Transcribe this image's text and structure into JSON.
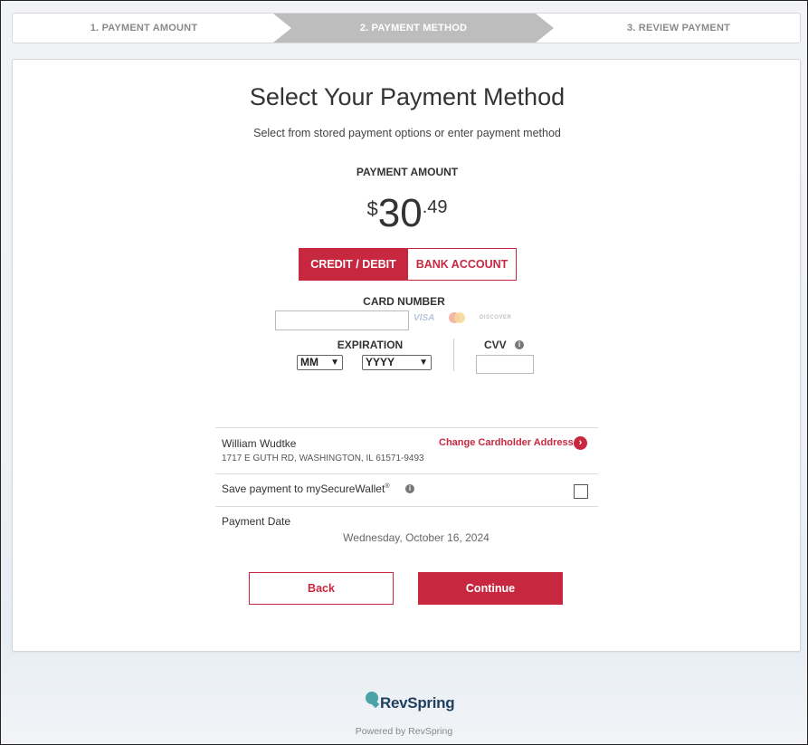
{
  "stepper": {
    "step1": "1. PAYMENT AMOUNT",
    "step2": "2. PAYMENT METHOD",
    "step3": "3. REVIEW PAYMENT"
  },
  "main": {
    "title": "Select Your Payment Method",
    "subtitle": "Select from stored payment options or enter payment method",
    "amount_label": "PAYMENT AMOUNT",
    "amount": {
      "currency": "$",
      "whole": "30",
      "cents": ".49"
    },
    "tabs": [
      {
        "label": "CREDIT / DEBIT",
        "active": true
      },
      {
        "label": "BANK ACCOUNT",
        "active": false
      }
    ],
    "card_number_label": "CARD NUMBER",
    "card_brands": {
      "visa": "VISA",
      "discover": "DISCOVER"
    },
    "expiration_label": "EXPIRATION",
    "month_select": "MM",
    "year_select": "YYYY",
    "cvv_label": "CVV",
    "cardholder": {
      "name": "William Wudtke",
      "address": "1717 E GUTH RD, WASHINGTON, IL 61571-9493",
      "change_link": "Change Cardholder Address"
    },
    "save_wallet": {
      "label": "Save payment to mySecureWallet",
      "mark": "®"
    },
    "payment_date_label": "Payment Date",
    "payment_date": "Wednesday, October 16, 2024",
    "back_label": "Back",
    "continue_label": "Continue"
  },
  "footer": {
    "logo_text": "RevSpring",
    "powered_by": "Powered by RevSpring"
  },
  "colors": {
    "accent": "#c8283f",
    "step_active": "#bdbdbd",
    "brand_dark": "#1f3f5f",
    "brand_teal": "#4aa3a8"
  }
}
